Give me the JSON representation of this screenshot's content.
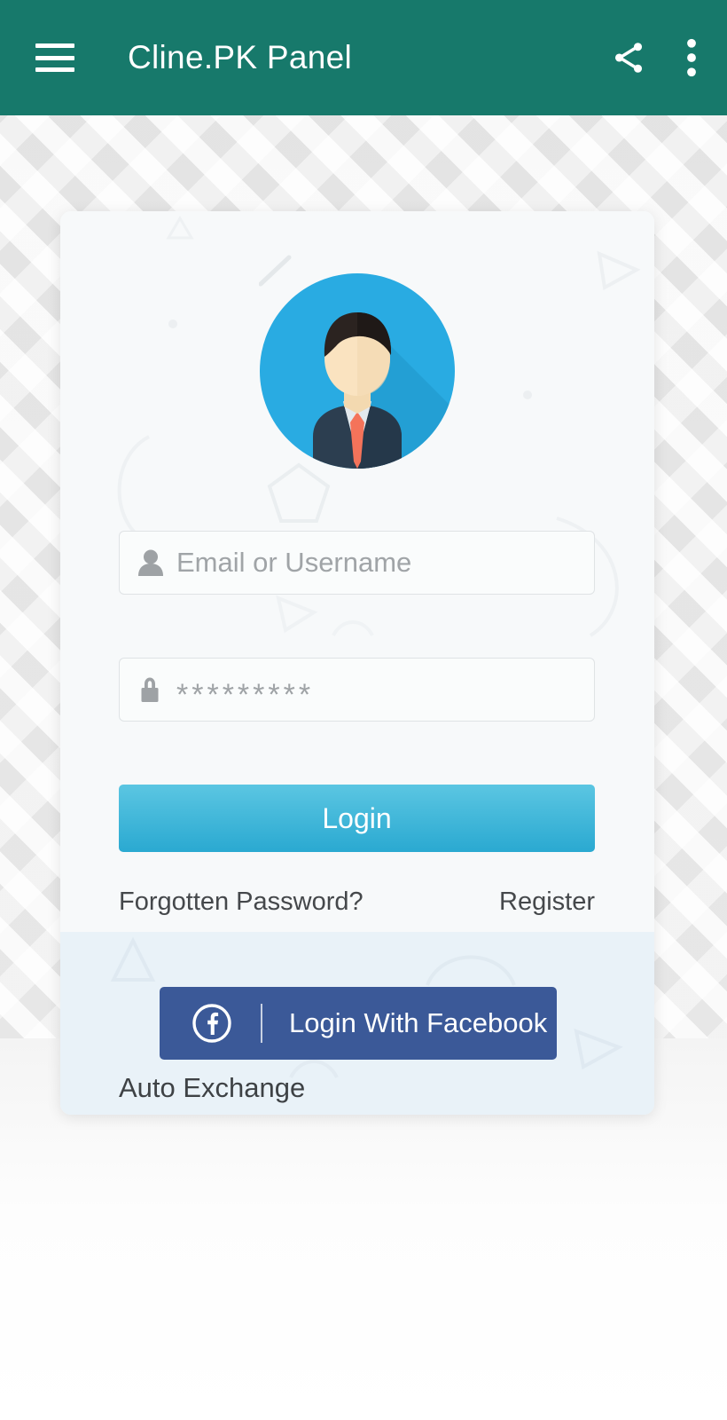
{
  "appbar": {
    "menu_icon": "hamburger-menu-icon",
    "title": "Cline.PK Panel",
    "share_icon": "share-icon",
    "overflow_icon": "more-vertical-icon",
    "background_color": "#17796b",
    "title_color": "#ffffff"
  },
  "card": {
    "avatar_icon": "user-avatar-businessman-icon",
    "avatar_circle_color": "#29ABE2",
    "form": {
      "username": {
        "icon": "person-icon",
        "placeholder": "Email or Username",
        "value": ""
      },
      "password": {
        "icon": "lock-icon",
        "placeholder": "*********",
        "value": ""
      },
      "login_button": {
        "label": "Login",
        "gradient_top": "#5bc6e2",
        "gradient_bottom": "#2aa9d1"
      }
    },
    "links": {
      "forgotten_password": "Forgotten Password?",
      "register": "Register"
    },
    "social": {
      "facebook_button": {
        "icon": "facebook-f-icon",
        "label": "Login With Facebook",
        "color": "#3b5998"
      },
      "auto_exchange": "Auto Exchange"
    },
    "background_color": "#f7f9fa",
    "bottom_panel_color": "#e9f2f8"
  }
}
